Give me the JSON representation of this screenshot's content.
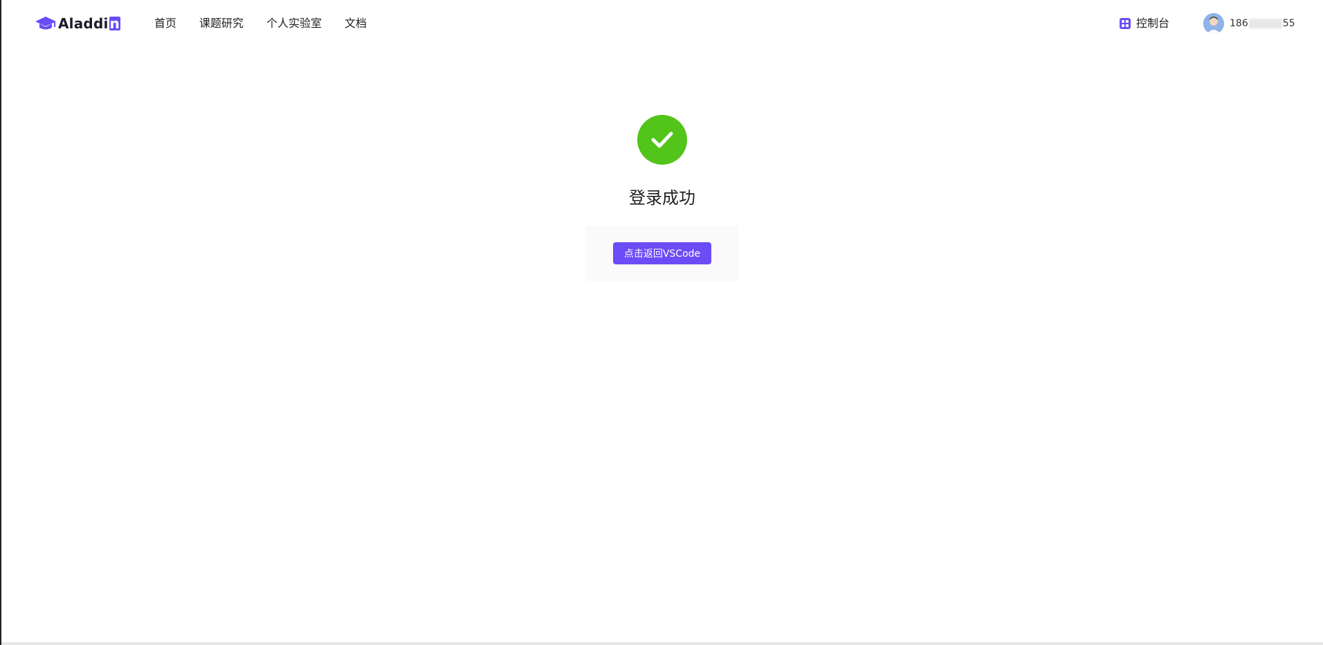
{
  "header": {
    "logo_text": "Aladdi",
    "logo_last_letter": "n",
    "nav": [
      {
        "label": "首页"
      },
      {
        "label": "课题研究"
      },
      {
        "label": "个人实验室"
      },
      {
        "label": "文档"
      }
    ],
    "console_label": "控制台",
    "user": {
      "name_prefix": "186",
      "name_suffix": "55"
    }
  },
  "result": {
    "status": "success",
    "title": "登录成功",
    "button_label": "点击返回VSCode"
  },
  "colors": {
    "brand": "#6b4cf6",
    "success": "#52c41a"
  }
}
